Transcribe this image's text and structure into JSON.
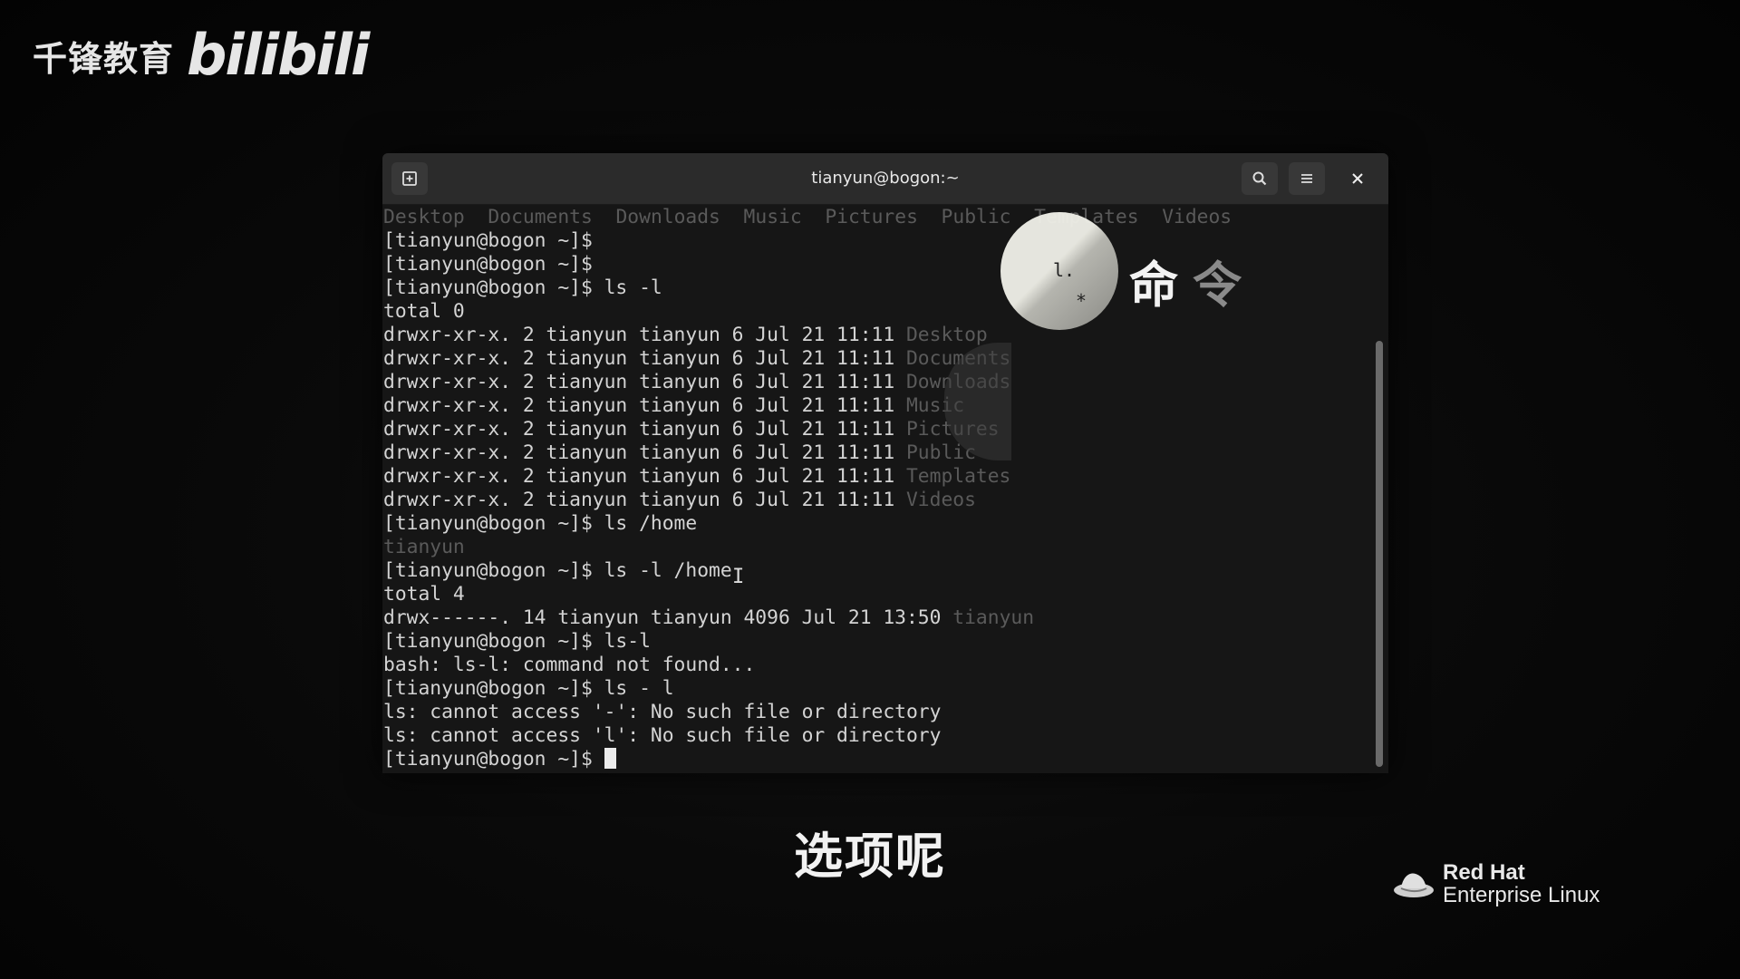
{
  "watermark": {
    "cn": "千锋教育",
    "bili": "bilibili"
  },
  "terminal": {
    "title": "tianyun@bogon:~",
    "icons": {
      "new_tab": "new-tab-icon",
      "search": "search-icon",
      "menu": "hamburger-menu-icon",
      "close": "close-icon"
    },
    "lines": [
      {
        "text": "",
        "dirs": [
          "Desktop",
          "Documents",
          "Downloads",
          "Music",
          "Pictures",
          "Public",
          "Templates",
          "Videos"
        ],
        "dir_separator": "  "
      },
      {
        "text": "[tianyun@bogon ~]$"
      },
      {
        "text": "[tianyun@bogon ~]$"
      },
      {
        "text": "[tianyun@bogon ~]$ ls -l"
      },
      {
        "text": "total 0"
      },
      {
        "text": "drwxr-xr-x. 2 tianyun tianyun 6 Jul 21 11:11 ",
        "dir": "Desktop"
      },
      {
        "text": "drwxr-xr-x. 2 tianyun tianyun 6 Jul 21 11:11 ",
        "dir": "Documents"
      },
      {
        "text": "drwxr-xr-x. 2 tianyun tianyun 6 Jul 21 11:11 ",
        "dir": "Downloads"
      },
      {
        "text": "drwxr-xr-x. 2 tianyun tianyun 6 Jul 21 11:11 ",
        "dir": "Music"
      },
      {
        "text": "drwxr-xr-x. 2 tianyun tianyun 6 Jul 21 11:11 ",
        "dir": "Pictures"
      },
      {
        "text": "drwxr-xr-x. 2 tianyun tianyun 6 Jul 21 11:11 ",
        "dir": "Public"
      },
      {
        "text": "drwxr-xr-x. 2 tianyun tianyun 6 Jul 21 11:11 ",
        "dir": "Templates"
      },
      {
        "text": "drwxr-xr-x. 2 tianyun tianyun 6 Jul 21 11:11 ",
        "dir": "Videos"
      },
      {
        "text": "[tianyun@bogon ~]$ ls /home"
      },
      {
        "text": "",
        "dir": "tianyun"
      },
      {
        "text": "[tianyun@bogon ~]$ ls -l /home"
      },
      {
        "text": "total 4"
      },
      {
        "text": "drwx------. 14 tianyun tianyun 4096 Jul 21 13:50 ",
        "dir": "tianyun"
      },
      {
        "text": "[tianyun@bogon ~]$ ls-l"
      },
      {
        "text": "bash: ls-l: command not found..."
      },
      {
        "text": "[tianyun@bogon ~]$ ls - l"
      },
      {
        "text": "ls: cannot access '-': No such file or directory"
      },
      {
        "text": "ls: cannot access 'l': No such file or directory"
      },
      {
        "text": "[tianyun@bogon ~]$ ",
        "cursor": true
      }
    ]
  },
  "overlay": {
    "disc_text": "l.",
    "disc_star": "*",
    "cn_1": "命",
    "cn_2": "令"
  },
  "subtitle": "选项呢",
  "redhat": {
    "brand": "Red Hat",
    "product": "Enterprise Linux"
  }
}
